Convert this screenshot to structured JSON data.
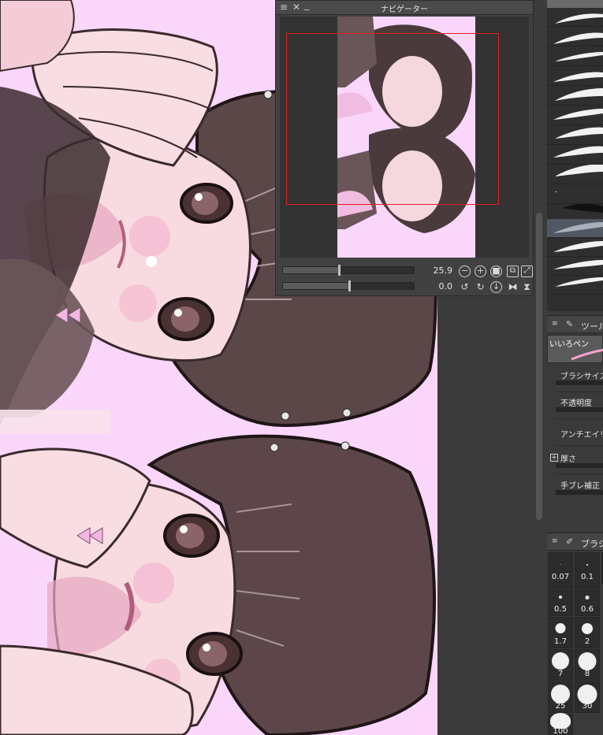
{
  "navigator": {
    "title": "ナビゲーター",
    "zoom_value": "25.9",
    "rotate_value": "0.0",
    "controls": [
      "≡",
      "✕",
      "_"
    ]
  },
  "tool_property": {
    "tab_label": "ツール",
    "subtool_name": "いいろペン",
    "properties": [
      "ブラシサイズ",
      "不透明度",
      "アンチエイリ",
      "厚さ",
      "手ブレ補正"
    ]
  },
  "brush_size": {
    "tab_label": "ブラシ",
    "sizes": [
      "0.07",
      "0.1",
      "0.5",
      "0.6",
      "1.7",
      "2",
      "7",
      "8",
      "25",
      "30",
      "100"
    ]
  },
  "colors": {
    "canvas_bg": "#fad6fb",
    "selection_frame": "#e22020",
    "selected_item": "#6e7a8f"
  }
}
